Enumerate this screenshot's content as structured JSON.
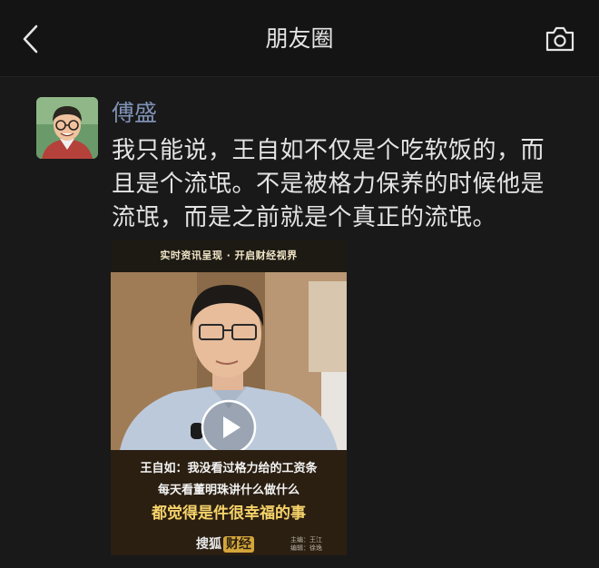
{
  "navbar": {
    "title": "朋友圈",
    "back_icon": "chevron-left-icon",
    "camera_icon": "camera-icon"
  },
  "post": {
    "username": "傅盛",
    "text": "我只能说，王自如不仅是个吃软饭的，而且是个流氓。不是被格力保养的时候他是流氓，而是之前就是个真正的流氓。",
    "video": {
      "banner": "实时资讯呈现 · 开启财经视界",
      "caption_line1": "王自如：我没看过格力给的工资条",
      "caption_line2": "每天看董明珠讲什么做什么",
      "caption_line3": "都觉得是件很幸福的事",
      "brand": "搜狐",
      "brand_badge": "财经",
      "credit_editor": "主编：王江",
      "credit_writer": "编辑：徐逸",
      "play_icon": "play-icon"
    }
  },
  "colors": {
    "background": "#191919",
    "username": "#7f92b6",
    "text": "#e4e4e4"
  }
}
